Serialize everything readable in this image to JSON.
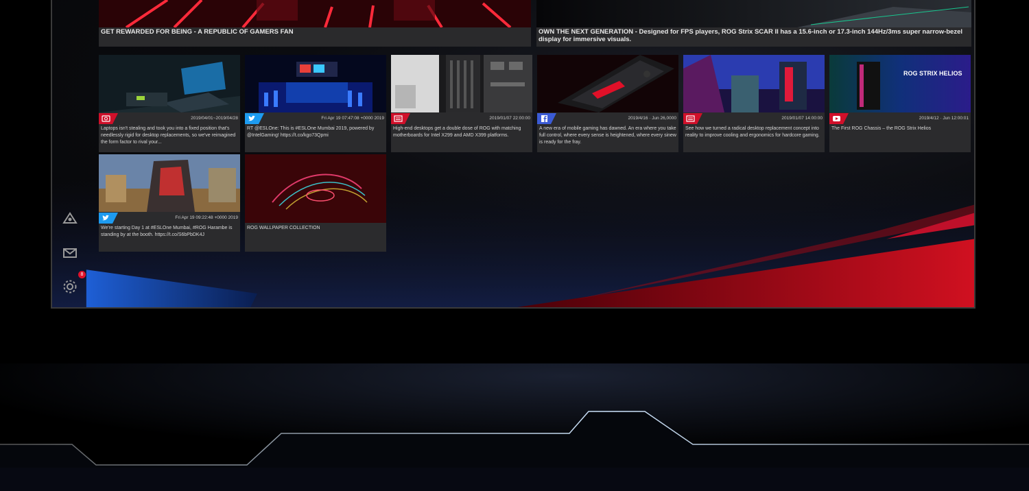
{
  "banners": [
    {
      "caption": "GET REWARDED FOR BEING - A REPUBLIC OF GAMERS FAN"
    },
    {
      "caption": "OWN THE NEXT GENERATION - Designed for FPS players, ROG Strix SCAR II has a 15.6-inch or 17.3-inch 144Hz/3ms super narrow-bezel display for immersive visuals."
    }
  ],
  "cards": [
    {
      "source": "instagram",
      "date": "2019/04/01~2019/04/28",
      "text": "Laptops isn't stealing and took you into a fixed position that's needlessly rigid for desktop replacements, so we've reimagined the form factor to rival your..."
    },
    {
      "source": "twitter",
      "date": "Fri Apr 19 07:47:08 +0000 2019",
      "text": "RT @ESLOne: This is #ESLOne Mumbai 2019, powered by @IntelGaming! https://t.co/kgo73Qpmi"
    },
    {
      "source": "news",
      "date": "2019/01/07 22:00:00",
      "text": "High-end desktops get a double dose of ROG with matching motherboards for Intel X299 and AMD X399 platforms."
    },
    {
      "source": "facebook",
      "date": "2019/4/16 · Jun 26,0000",
      "text": "A new era of mobile gaming has dawned. An era where you take full control, where every sense is heightened, where every sinew is ready for the fray."
    },
    {
      "source": "news",
      "date": "2019/01/07 14:00:00",
      "text": "See how we turned a radical desktop replacement concept into reality to improve cooling and ergonomics for hardcore gaming."
    },
    {
      "source": "youtube",
      "date": "2019/4/12 · Jun 12:00:01",
      "text": "The First ROG Chassis – the ROG Strix Helios"
    },
    {
      "source": "twitter",
      "date": "Fri Apr 19 09:22:48 +0000 2019",
      "text": "We're starting Day 1 at #ESLOne Mumbai, #ROG Harambe is standing by at the booth. https://t.co/S6bPbDK4J"
    },
    {
      "source": "none",
      "date": "",
      "text": "ROG WALLPAPER COLLECTION"
    }
  ],
  "thumb_overlay": "ROG STRIX HELIOS",
  "notification_count": "8",
  "colors": {
    "accent_red": "#e0102a",
    "accent_blue": "#1e5fd6",
    "card_bg": "#2b2b2d"
  }
}
